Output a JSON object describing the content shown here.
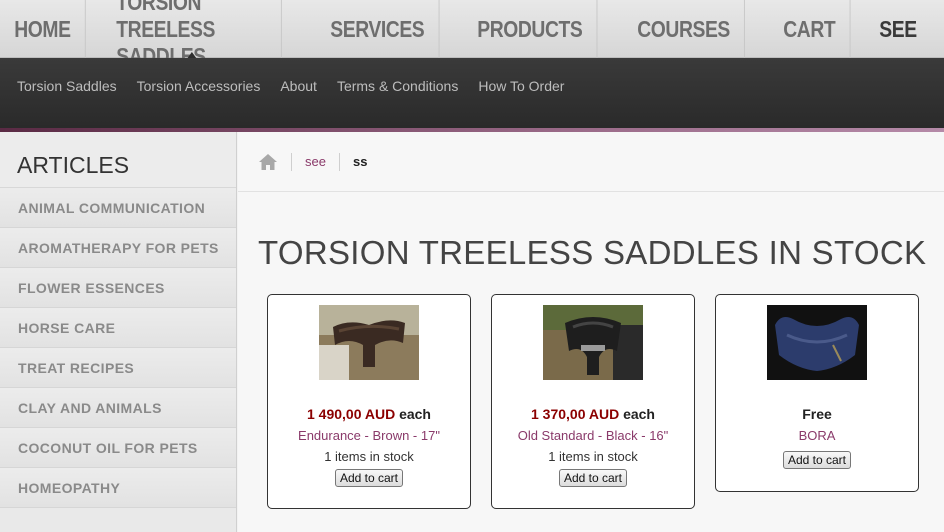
{
  "topnav": {
    "items": [
      "HOME",
      "TORSION TREELESS SADDLES",
      "SERVICES",
      "PRODUCTS",
      "COURSES",
      "CART",
      "SEE"
    ],
    "active_index": 6
  },
  "subnav": {
    "items": [
      "Torsion Saddles",
      "Torsion Accessories",
      "About",
      "Terms & Conditions",
      "How To Order"
    ]
  },
  "sidebar": {
    "heading": "ARTICLES",
    "categories": [
      "ANIMAL COMMUNICATION",
      "AROMATHERAPY FOR PETS",
      "FLOWER ESSENCES",
      "HORSE CARE",
      "TREAT RECIPES",
      "CLAY AND ANIMALS",
      "COCONUT OIL FOR PETS",
      "HOMEOPATHY"
    ]
  },
  "breadcrumb": {
    "icon": "home-icon",
    "link": "see",
    "current": "ss"
  },
  "main": {
    "title": "TORSION TREELESS SADDLES IN STOCK"
  },
  "products": [
    {
      "price": "1 490,00 AUD",
      "each": "each",
      "name": "Endurance - Brown - 17\"",
      "stock": "1 items in stock",
      "button": "Add to cart"
    },
    {
      "price": "1 370,00 AUD",
      "each": "each",
      "name": "Old Standard - Black - 16\"",
      "stock": "1 items in stock",
      "button": "Add to cart"
    },
    {
      "price": "Free",
      "name": "BORA",
      "button": "Add to cart"
    }
  ],
  "colors": {
    "accent": "#8a3a6a",
    "price": "#8b0000"
  }
}
